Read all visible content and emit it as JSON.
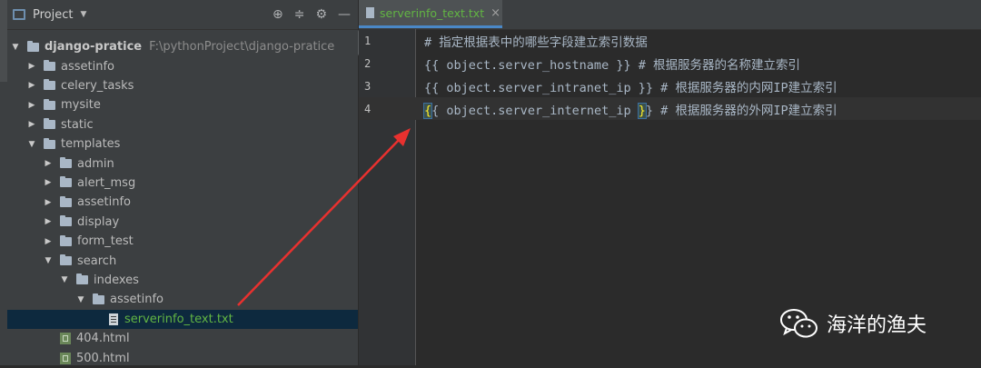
{
  "project_panel": {
    "title": "Project",
    "tools": [
      "⊕",
      "≑",
      "⚙",
      "—"
    ],
    "root": {
      "name": "django-pratice",
      "path": "F:\\pythonProject\\django-pratice"
    },
    "tree": [
      {
        "label": "assetinfo",
        "type": "folder",
        "depth": 1,
        "expanded": false
      },
      {
        "label": "celery_tasks",
        "type": "folder",
        "depth": 1,
        "expanded": false
      },
      {
        "label": "mysite",
        "type": "folder",
        "depth": 1,
        "expanded": false
      },
      {
        "label": "static",
        "type": "folder",
        "depth": 1,
        "expanded": false
      },
      {
        "label": "templates",
        "type": "folder",
        "depth": 1,
        "expanded": true
      },
      {
        "label": "admin",
        "type": "folder",
        "depth": 2,
        "expanded": false
      },
      {
        "label": "alert_msg",
        "type": "folder",
        "depth": 2,
        "expanded": false
      },
      {
        "label": "assetinfo",
        "type": "folder",
        "depth": 2,
        "expanded": false
      },
      {
        "label": "display",
        "type": "folder",
        "depth": 2,
        "expanded": false
      },
      {
        "label": "form_test",
        "type": "folder",
        "depth": 2,
        "expanded": false
      },
      {
        "label": "search",
        "type": "folder",
        "depth": 2,
        "expanded": true
      },
      {
        "label": "indexes",
        "type": "folder",
        "depth": 3,
        "expanded": true
      },
      {
        "label": "assetinfo",
        "type": "folder",
        "depth": 4,
        "expanded": true
      },
      {
        "label": "serverinfo_text.txt",
        "type": "file",
        "depth": 5,
        "selected": true
      },
      {
        "label": "404.html",
        "type": "html",
        "depth": 2
      },
      {
        "label": "500.html",
        "type": "html",
        "depth": 2
      }
    ]
  },
  "editor": {
    "tab": {
      "label": "serverinfo_text.txt",
      "close": "×"
    },
    "lines": [
      {
        "num": "1",
        "text": "# 指定根据表中的哪些字段建立索引数据"
      },
      {
        "num": "2",
        "text": "{{ object.server_hostname }} # 根据服务器的名称建立索引"
      },
      {
        "num": "3",
        "text": "{{ object.server_intranet_ip }} # 根据服务器的内网IP建立索引"
      },
      {
        "num": "4",
        "text_before": "{",
        "bracket_open": "{",
        "text_mid": " object.server_internet_ip ",
        "bracket_close": "}",
        "text_after": "} # 根据服务器的外网IP建立索引",
        "current": true
      }
    ]
  },
  "watermark": {
    "text": "海洋的渔夫"
  },
  "colors": {
    "accent": "#4a88c7",
    "arrow": "#e8312f",
    "selection": "#0d293e",
    "file_green": "#62b543"
  }
}
